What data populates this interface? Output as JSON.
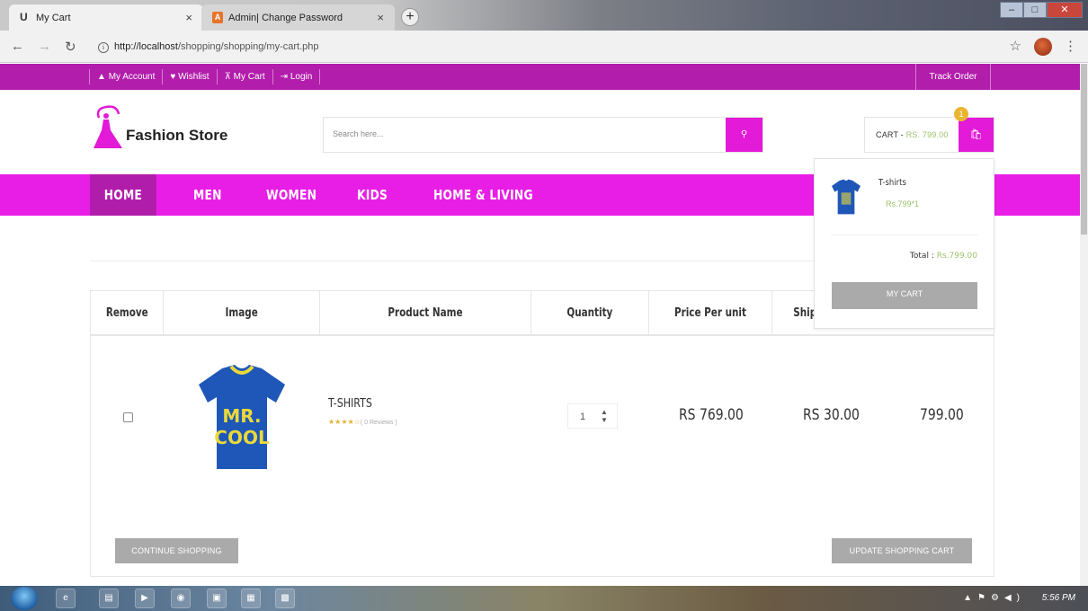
{
  "browser": {
    "tabs": [
      {
        "title": "My Cart",
        "favicon": "U"
      },
      {
        "title": "Admin| Change Password",
        "favicon": "A"
      }
    ],
    "new_tab_label": "+",
    "url_host": "http://localhost",
    "url_path": "/shopping/shopping/my-cart.php"
  },
  "topbar": {
    "links": [
      {
        "icon": "user-icon",
        "glyph": "▲",
        "label": "My Account"
      },
      {
        "icon": "heart-icon",
        "glyph": "♥",
        "label": "Wishlist"
      },
      {
        "icon": "cart-icon",
        "glyph": "⊼",
        "label": "My Cart"
      },
      {
        "icon": "login-icon",
        "glyph": "⇥",
        "label": "Login"
      }
    ],
    "track_order": "Track Order"
  },
  "header": {
    "logo_text": "Fashion Store",
    "search_placeholder": "Search here...",
    "cart_label": "CART - ",
    "cart_amount": "RS. 799.00",
    "cart_count": "1"
  },
  "nav": {
    "items": [
      "HOME",
      "MEN",
      "WOMEN",
      "KIDS",
      "HOME & LIVING"
    ]
  },
  "dropdown": {
    "item_name": "T-shirts",
    "item_price": "Rs.799*1",
    "total_label": "Total : ",
    "total_value": "Rs.799.00",
    "button": "MY CART"
  },
  "table": {
    "headers": [
      "Remove",
      "Image",
      "Product Name",
      "Quantity",
      "Price Per unit",
      "Ship"
    ],
    "row": {
      "product_name": "T-SHIRTS",
      "stars": "★★★★☆",
      "reviews": "( 0 Reviews )",
      "quantity": "1",
      "price_per_unit": "RS 769.00",
      "shipping": "RS 30.00",
      "grand_total": "799.00"
    },
    "continue_button": "CONTINUE SHOPPING",
    "update_button": "UPDATE SHOPPING CART"
  },
  "product_image_text": [
    "MR.",
    "COOL"
  ],
  "colors": {
    "topbar": "#b21dab",
    "nav": "#e81ee6",
    "accent": "#e31ad7",
    "price_green": "#9cc36a",
    "badge": "#e9b531"
  },
  "taskbar": {
    "clock": "5:56 PM"
  }
}
